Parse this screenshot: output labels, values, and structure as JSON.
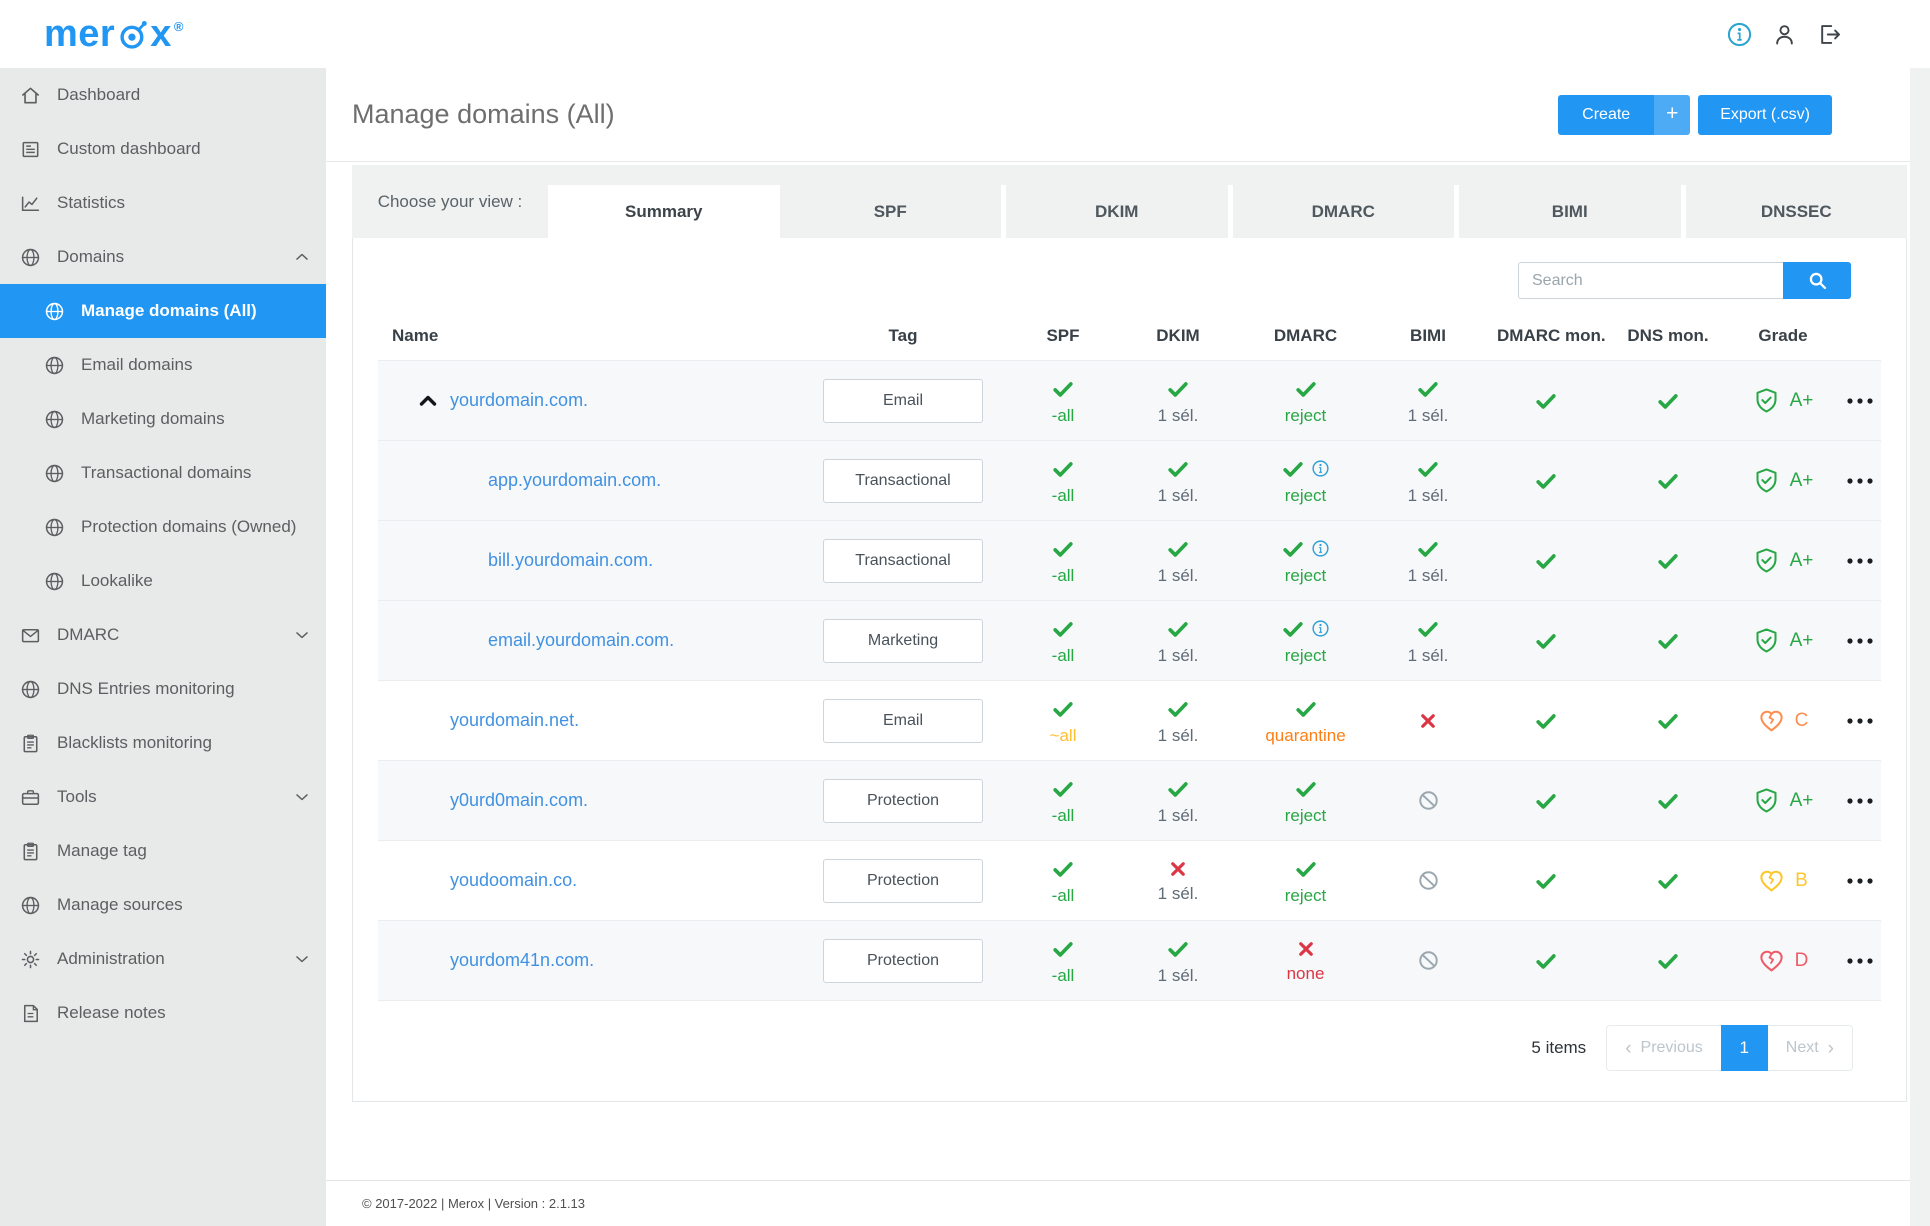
{
  "colors": {
    "accent": "#2196f3",
    "green": "#28a745",
    "gray": "#5f6b76",
    "yellow": "#fcbf2e",
    "orange": "#fd7e14",
    "red": "#dc3545",
    "ban": "#9aa7ae",
    "info": "#2e9fd6",
    "gradeA": "#28a745",
    "gradeB": "#fcc72c",
    "gradeC": "#fd8e4f",
    "gradeD": "#ee5b68"
  },
  "topbar": {
    "logo_prefix": "mer",
    "logo_suffix": "x",
    "registered_mark": "®",
    "icons": [
      "info",
      "user",
      "logout"
    ]
  },
  "sidebar": {
    "items": [
      {
        "label": "Dashboard",
        "icon": "home"
      },
      {
        "label": "Custom dashboard",
        "icon": "board"
      },
      {
        "label": "Statistics",
        "icon": "chart"
      },
      {
        "label": "Domains",
        "icon": "globe",
        "chevron": "up"
      },
      {
        "label": "Manage domains (All)",
        "icon": "globe",
        "sub": true,
        "active": true
      },
      {
        "label": "Email domains",
        "icon": "globe",
        "sub": true
      },
      {
        "label": "Marketing domains",
        "icon": "globe",
        "sub": true
      },
      {
        "label": "Transactional domains",
        "icon": "globe",
        "sub": true
      },
      {
        "label": "Protection domains (Owned)",
        "icon": "globe",
        "sub": true
      },
      {
        "label": "Lookalike",
        "icon": "globe",
        "sub": true
      },
      {
        "label": "DMARC",
        "icon": "envelope",
        "chevron": "down"
      },
      {
        "label": "DNS Entries monitoring",
        "icon": "globe"
      },
      {
        "label": "Blacklists monitoring",
        "icon": "clipboard"
      },
      {
        "label": "Tools",
        "icon": "toolbox",
        "chevron": "down"
      },
      {
        "label": "Manage tag",
        "icon": "clipboard"
      },
      {
        "label": "Manage sources",
        "icon": "globe"
      },
      {
        "label": "Administration",
        "icon": "gear",
        "chevron": "down"
      },
      {
        "label": "Release notes",
        "icon": "file"
      }
    ]
  },
  "header": {
    "title": "Manage domains (All)",
    "create_label": "Create",
    "create_plus": "+",
    "export_label": "Export (.csv)"
  },
  "tabs": {
    "label": "Choose your view :",
    "items": [
      "Summary",
      "SPF",
      "DKIM",
      "DMARC",
      "BIMI",
      "DNSSEC"
    ],
    "active": "Summary"
  },
  "search": {
    "placeholder": "Search"
  },
  "table": {
    "columns": [
      {
        "key": "name",
        "label": "Name"
      },
      {
        "key": "tag",
        "label": "Tag"
      },
      {
        "key": "spf",
        "label": "SPF"
      },
      {
        "key": "dkim",
        "label": "DKIM"
      },
      {
        "key": "dmarc",
        "label": "DMARC"
      },
      {
        "key": "bimi",
        "label": "BIMI"
      },
      {
        "key": "dmarc_mon",
        "label": "DMARC mon."
      },
      {
        "key": "dns_mon",
        "label": "DNS mon."
      },
      {
        "key": "grade",
        "label": "Grade"
      },
      {
        "key": "actions",
        "label": ""
      }
    ],
    "rows": [
      {
        "name": "yourdomain.com.",
        "caret": true,
        "indent": false,
        "tinted": true,
        "tag": "Email",
        "spf": {
          "icon": "check",
          "text": "-all",
          "color": "green"
        },
        "dkim": {
          "icon": "check",
          "text": "1 sél.",
          "color": "gray"
        },
        "dmarc": {
          "icon": "check",
          "info": false,
          "text": "reject",
          "color": "green"
        },
        "bimi": {
          "icon": "check",
          "text": "1 sél.",
          "color": "gray"
        },
        "dmarc_mon": {
          "icon": "check"
        },
        "dns_mon": {
          "icon": "check"
        },
        "grade": {
          "icon": "shield-check",
          "label": "A+",
          "color": "gradeA"
        }
      },
      {
        "name": "app.yourdomain.com.",
        "caret": false,
        "indent": true,
        "tinted": true,
        "tag": "Transactional",
        "spf": {
          "icon": "check",
          "text": "-all",
          "color": "green"
        },
        "dkim": {
          "icon": "check",
          "text": "1 sél.",
          "color": "gray"
        },
        "dmarc": {
          "icon": "check",
          "info": true,
          "text": "reject",
          "color": "green"
        },
        "bimi": {
          "icon": "check",
          "text": "1 sél.",
          "color": "gray"
        },
        "dmarc_mon": {
          "icon": "check"
        },
        "dns_mon": {
          "icon": "check"
        },
        "grade": {
          "icon": "shield-check",
          "label": "A+",
          "color": "gradeA"
        }
      },
      {
        "name": "bill.yourdomain.com.",
        "caret": false,
        "indent": true,
        "tinted": true,
        "tag": "Transactional",
        "spf": {
          "icon": "check",
          "text": "-all",
          "color": "green"
        },
        "dkim": {
          "icon": "check",
          "text": "1 sél.",
          "color": "gray"
        },
        "dmarc": {
          "icon": "check",
          "info": true,
          "text": "reject",
          "color": "green"
        },
        "bimi": {
          "icon": "check",
          "text": "1 sél.",
          "color": "gray"
        },
        "dmarc_mon": {
          "icon": "check"
        },
        "dns_mon": {
          "icon": "check"
        },
        "grade": {
          "icon": "shield-check",
          "label": "A+",
          "color": "gradeA"
        }
      },
      {
        "name": "email.yourdomain.com.",
        "caret": false,
        "indent": true,
        "tinted": true,
        "tag": "Marketing",
        "spf": {
          "icon": "check",
          "text": "-all",
          "color": "green"
        },
        "dkim": {
          "icon": "check",
          "text": "1 sél.",
          "color": "gray"
        },
        "dmarc": {
          "icon": "check",
          "info": true,
          "text": "reject",
          "color": "green"
        },
        "bimi": {
          "icon": "check",
          "text": "1 sél.",
          "color": "gray"
        },
        "dmarc_mon": {
          "icon": "check"
        },
        "dns_mon": {
          "icon": "check"
        },
        "grade": {
          "icon": "shield-check",
          "label": "A+",
          "color": "gradeA"
        }
      },
      {
        "name": "yourdomain.net.",
        "caret": false,
        "indent": false,
        "tinted": false,
        "tag": "Email",
        "spf": {
          "icon": "check",
          "text": "~all",
          "color": "yellow"
        },
        "dkim": {
          "icon": "check",
          "text": "1 sél.",
          "color": "gray"
        },
        "dmarc": {
          "icon": "check",
          "info": false,
          "text": "quarantine",
          "color": "orange"
        },
        "bimi": {
          "icon": "cross"
        },
        "dmarc_mon": {
          "icon": "check"
        },
        "dns_mon": {
          "icon": "check"
        },
        "grade": {
          "icon": "broken-heart",
          "label": "C",
          "color": "gradeC"
        }
      },
      {
        "name": "y0urd0main.com.",
        "caret": false,
        "indent": false,
        "tinted": true,
        "tag": "Protection",
        "spf": {
          "icon": "check",
          "text": "-all",
          "color": "green"
        },
        "dkim": {
          "icon": "check",
          "text": "1 sél.",
          "color": "gray"
        },
        "dmarc": {
          "icon": "check",
          "info": false,
          "text": "reject",
          "color": "green"
        },
        "bimi": {
          "icon": "ban"
        },
        "dmarc_mon": {
          "icon": "check"
        },
        "dns_mon": {
          "icon": "check"
        },
        "grade": {
          "icon": "shield-check",
          "label": "A+",
          "color": "gradeA"
        }
      },
      {
        "name": "youdoomain.co.",
        "caret": false,
        "indent": false,
        "tinted": false,
        "tag": "Protection",
        "spf": {
          "icon": "check",
          "text": "-all",
          "color": "green"
        },
        "dkim": {
          "icon": "cross",
          "text": "1 sél.",
          "color": "gray"
        },
        "dmarc": {
          "icon": "check",
          "info": false,
          "text": "reject",
          "color": "green"
        },
        "bimi": {
          "icon": "ban"
        },
        "dmarc_mon": {
          "icon": "check"
        },
        "dns_mon": {
          "icon": "check"
        },
        "grade": {
          "icon": "broken-heart",
          "label": "B",
          "color": "gradeB"
        }
      },
      {
        "name": "yourdom41n.com.",
        "caret": false,
        "indent": false,
        "tinted": true,
        "tag": "Protection",
        "spf": {
          "icon": "check",
          "text": "-all",
          "color": "green"
        },
        "dkim": {
          "icon": "check",
          "text": "1 sél.",
          "color": "gray"
        },
        "dmarc": {
          "icon": "cross",
          "info": false,
          "text": "none",
          "color": "red"
        },
        "bimi": {
          "icon": "ban"
        },
        "dmarc_mon": {
          "icon": "check"
        },
        "dns_mon": {
          "icon": "check"
        },
        "grade": {
          "icon": "broken-heart",
          "label": "D",
          "color": "gradeD"
        }
      }
    ]
  },
  "pagination": {
    "items_label": "5 items",
    "prev_icon": "‹",
    "previous_label": "Previous",
    "page": "1",
    "next_label": "Next",
    "next_icon": "›"
  },
  "footer": {
    "text": "© 2017-2022 | Merox | Version : 2.1.13"
  }
}
